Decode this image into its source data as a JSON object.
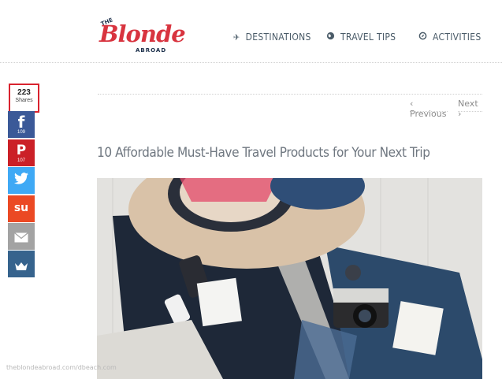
{
  "logo": {
    "the": "THE",
    "blonde": "Blonde",
    "abroad": "ABROAD"
  },
  "nav": {
    "destinations": {
      "icon": "plane-icon",
      "label": "DESTINATIONS"
    },
    "travel_tips": {
      "icon": "globe-icon",
      "label": "TRAVEL TIPS"
    },
    "activities": {
      "icon": "compass-icon",
      "label": "ACTIVITIES"
    }
  },
  "share": {
    "count": "223",
    "count_label": "Shares",
    "buttons": [
      {
        "icon": "facebook-icon",
        "glyph": "f",
        "count": "109",
        "color": "#3b5998"
      },
      {
        "icon": "pinterest-icon",
        "glyph": "P",
        "count": "107",
        "color": "#cb2027"
      },
      {
        "icon": "twitter-icon",
        "glyph": "🐦",
        "count": "",
        "color": "#3fa9f5"
      },
      {
        "icon": "stumbleupon-icon",
        "glyph": "su",
        "count": "",
        "color": "#eb4924"
      },
      {
        "icon": "email-icon",
        "glyph": "✉",
        "count": "",
        "color": "#a3a3a3"
      },
      {
        "icon": "crown-icon",
        "glyph": "♛",
        "count": "",
        "color": "#36638d"
      }
    ]
  },
  "pager": {
    "prev": "‹ Previous",
    "next": "Next ›"
  },
  "post": {
    "title": "10 Affordable Must-Have Travel Products for Your Next Trip"
  },
  "watermark": "theblondeabroad.com/dbeach.com",
  "colors": {
    "accent": "#d9232f",
    "nav_text": "#4a5b68"
  }
}
